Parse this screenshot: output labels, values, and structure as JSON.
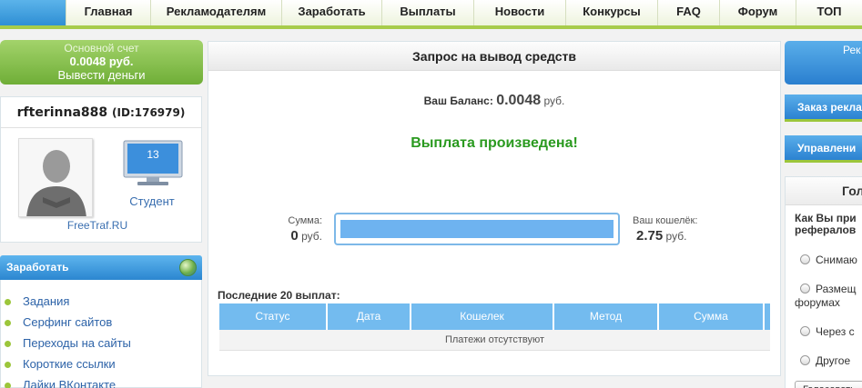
{
  "nav": {
    "items": [
      "Главная",
      "Рекламодателям",
      "Заработать",
      "Выплаты",
      "Новости",
      "Конкурсы",
      "FAQ",
      "Форум",
      "ТОП"
    ]
  },
  "account": {
    "label": "Основной счет",
    "balance": "0.0048 руб.",
    "withdraw": "Вывести деньги"
  },
  "user": {
    "name": "rfterinna888",
    "id": "(ID:176979)",
    "site": "FreeTraf.RU",
    "level": "13",
    "status": "Студент"
  },
  "earn": {
    "title": "Заработать",
    "items": [
      "Задания",
      "Серфинг сайтов",
      "Переходы на сайты",
      "Короткие ссылки",
      "Лайки ВКонтакте"
    ]
  },
  "main": {
    "title": "Запрос на вывод средств",
    "balance_label": "Ваш Баланс:",
    "balance_value": "0.0048",
    "balance_unit": "руб.",
    "success": "Выплата произведена!",
    "sum_label": "Сумма:",
    "sum_value": "0",
    "sum_unit": "руб.",
    "wallet_label": "Ваш кошелёк:",
    "wallet_value": "2.75",
    "wallet_unit": "руб.",
    "amount_fill": 1.0,
    "last_title": "Последние 20 выплат:",
    "columns": [
      "Статус",
      "Дата",
      "Кошелек",
      "Метод",
      "Сумма"
    ],
    "empty": "Платежи отсутствуют"
  },
  "right": {
    "btn1": "Рек",
    "btn2": "Заказ рекла",
    "btn3": "Управлени",
    "poll_title": "Гол",
    "poll_q1": "Как Вы при",
    "poll_q2": "рефералов",
    "options": [
      "Снимаю",
      "Размещ",
      "форумах",
      "Через с",
      "Другое"
    ],
    "vote": "Голосовать"
  },
  "colors": {
    "accent_green": "#a7cc4a",
    "success_text": "#2a9a1f",
    "header_blue": "#73bbef"
  }
}
